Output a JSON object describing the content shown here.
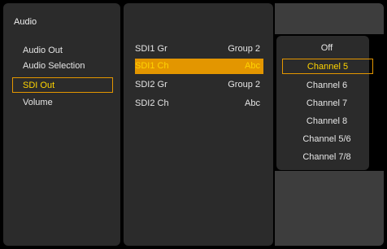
{
  "title": "Audio",
  "left_menu": [
    {
      "label": "Audio Out"
    },
    {
      "label": "Audio Selection"
    },
    {
      "label": "SDI Out"
    },
    {
      "label": "Volume"
    }
  ],
  "middle_rows": [
    {
      "key": "SDI1 Gr",
      "value": "Group 2"
    },
    {
      "key": "SDI1 Ch",
      "value": "Abc"
    },
    {
      "key": "SDI2 Gr",
      "value": "Group 2"
    },
    {
      "key": "SDI2 Ch",
      "value": "Abc"
    }
  ],
  "dropdown_options": [
    "Off",
    "Channel 5",
    "Channel 6",
    "Channel 7",
    "Channel 8",
    "Channel 5/6",
    "Channel 7/8"
  ],
  "colors": {
    "accent": "#e39600",
    "selected_text": "#ffd400",
    "panel": "#2b2b2b",
    "background": "#000000"
  }
}
